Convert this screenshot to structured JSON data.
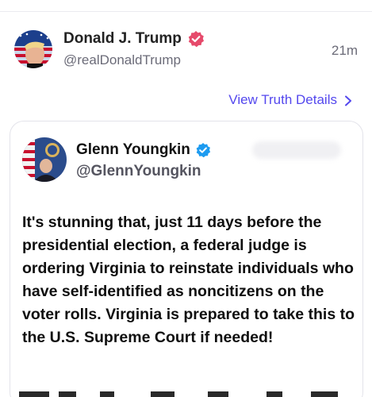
{
  "post": {
    "display_name": "Donald J. Trump",
    "handle": "@realDonaldTrump",
    "time": "21m",
    "avatar_icon": "profile-photo",
    "badge_icon": "verified-badge-red",
    "badge_color": "#e64a6b"
  },
  "details_link": {
    "label": "View Truth Details",
    "icon": "chevron-right-icon",
    "color": "#5448ee"
  },
  "quoted": {
    "display_name": "Glenn Youngkin",
    "handle": "@GlennYoungkin",
    "badge_icon": "verified-badge-blue",
    "badge_color": "#1d9bf0",
    "text": "It's stunning that, just 11 days before the presidential election, a federal judge is ordering Virginia to reinstate individuals who have self-identified as noncitizens on the voter rolls. Virginia is prepared to take this to the U.S. Supreme Court if needed!"
  }
}
